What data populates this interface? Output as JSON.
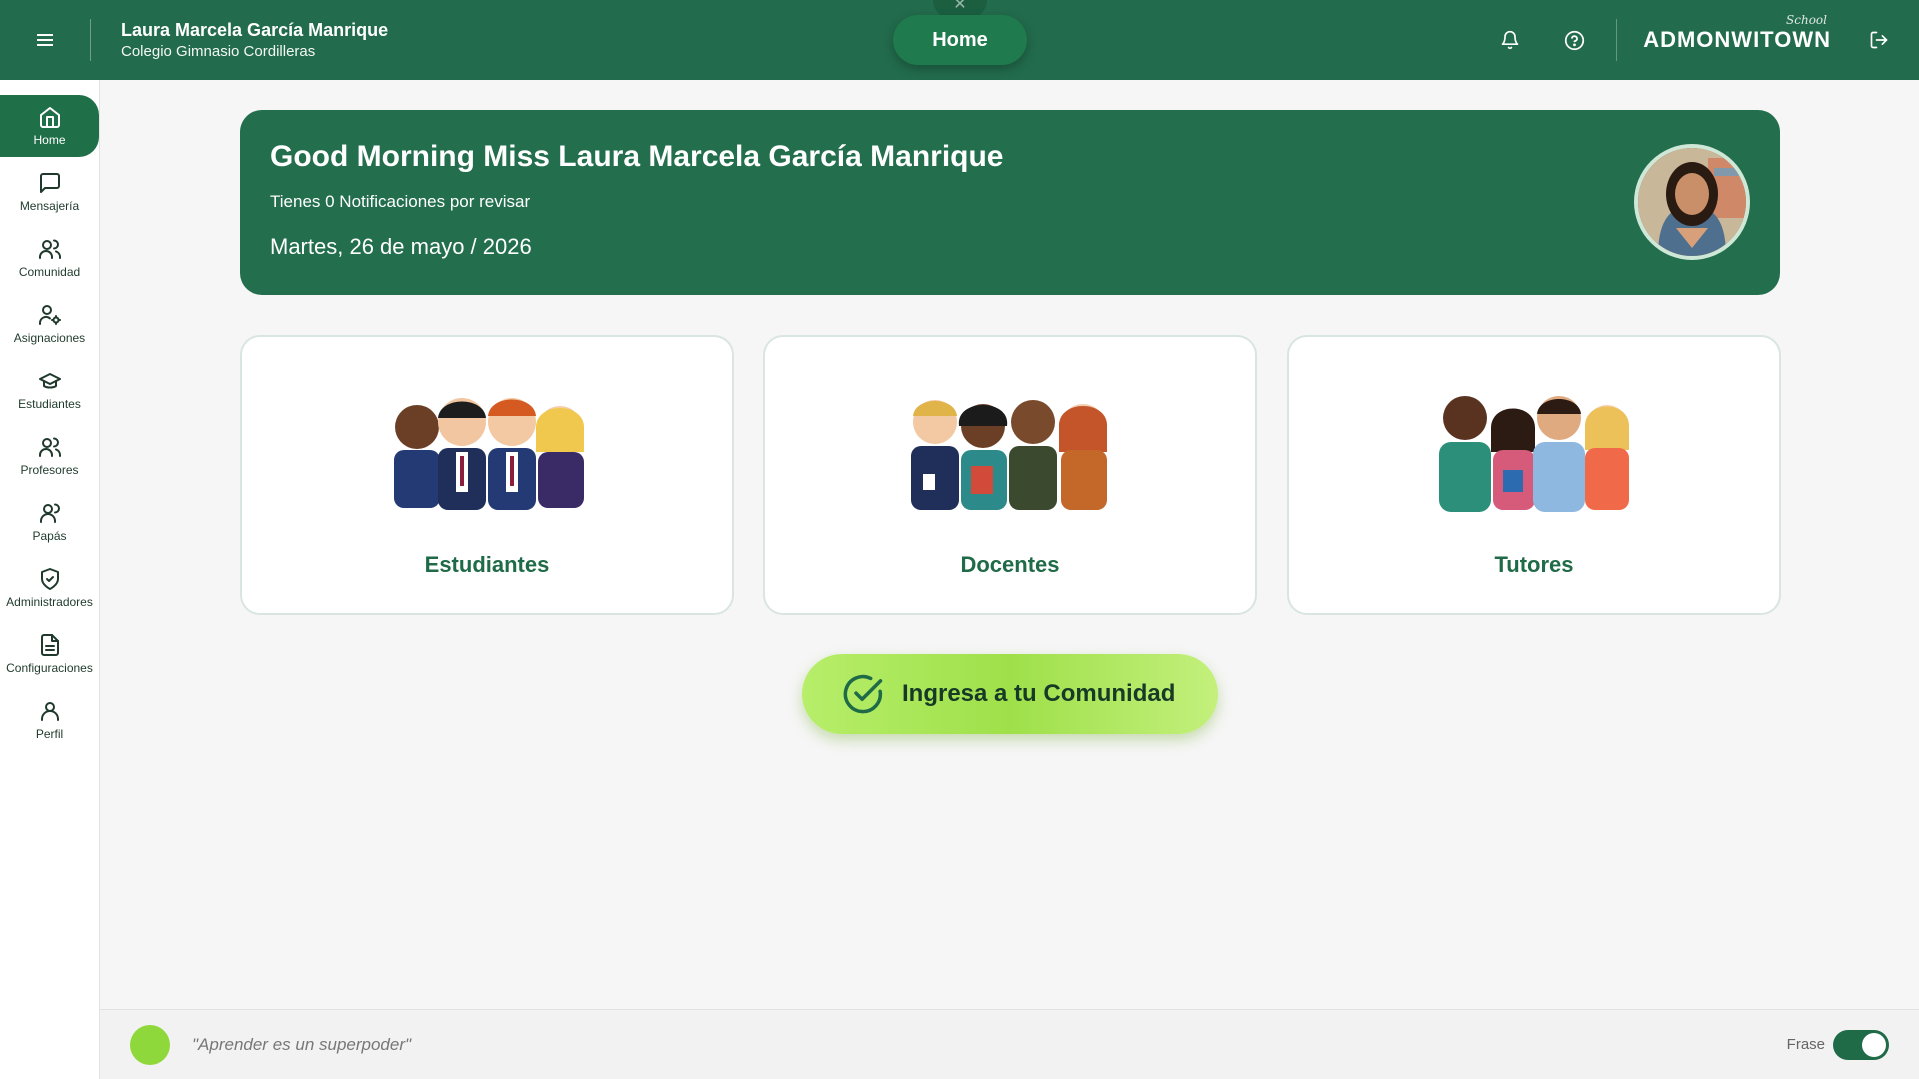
{
  "header": {
    "menu_icon": "hamburger-icon",
    "user_name": "Laura Marcela García Manrique",
    "school_name": "Colegio Gimnasio Cordilleras",
    "center_tab": "Home",
    "brand_name": "ADMONWITOWN",
    "brand_tag": "School",
    "icons": [
      "bell-icon",
      "help-icon",
      "logout-icon"
    ],
    "bg_color": "#226b4c"
  },
  "sidebar": {
    "items": [
      {
        "label": "Home",
        "icon": "home-icon",
        "active": true
      },
      {
        "label": "Mensajería",
        "icon": "message-icon"
      },
      {
        "label": "Comunidad",
        "icon": "users-icon"
      },
      {
        "label": "Asignaciones",
        "icon": "user-gear-icon"
      },
      {
        "label": "Estudiantes",
        "icon": "graduation-cap-icon"
      },
      {
        "label": "Profesores",
        "icon": "users-icon"
      },
      {
        "label": "Papás",
        "icon": "users-icon"
      },
      {
        "label": "Administradores",
        "icon": "shield-check-icon"
      },
      {
        "label": "Configuraciones",
        "icon": "document-icon"
      },
      {
        "label": "Perfil",
        "icon": "user-icon"
      }
    ]
  },
  "banner": {
    "greeting": "Good Morning Miss Laura Marcela García Manrique",
    "notifications": "Tienes 0 Notificaciones por revisar",
    "date": "Martes, 26 de mayo / 2026",
    "bg_color": "#226e4d"
  },
  "cards": [
    {
      "label": "Estudiantes",
      "image": "students-illustration"
    },
    {
      "label": "Docentes",
      "image": "teachers-illustration"
    },
    {
      "label": "Tutores",
      "image": "parents-illustration"
    }
  ],
  "cta": {
    "label": "Ingresa a tu Comunidad",
    "icon": "check-circle-icon"
  },
  "footer": {
    "quote": "\"Aprender es un superpoder\"",
    "toggle_label": "Frase",
    "toggle_on": true
  }
}
